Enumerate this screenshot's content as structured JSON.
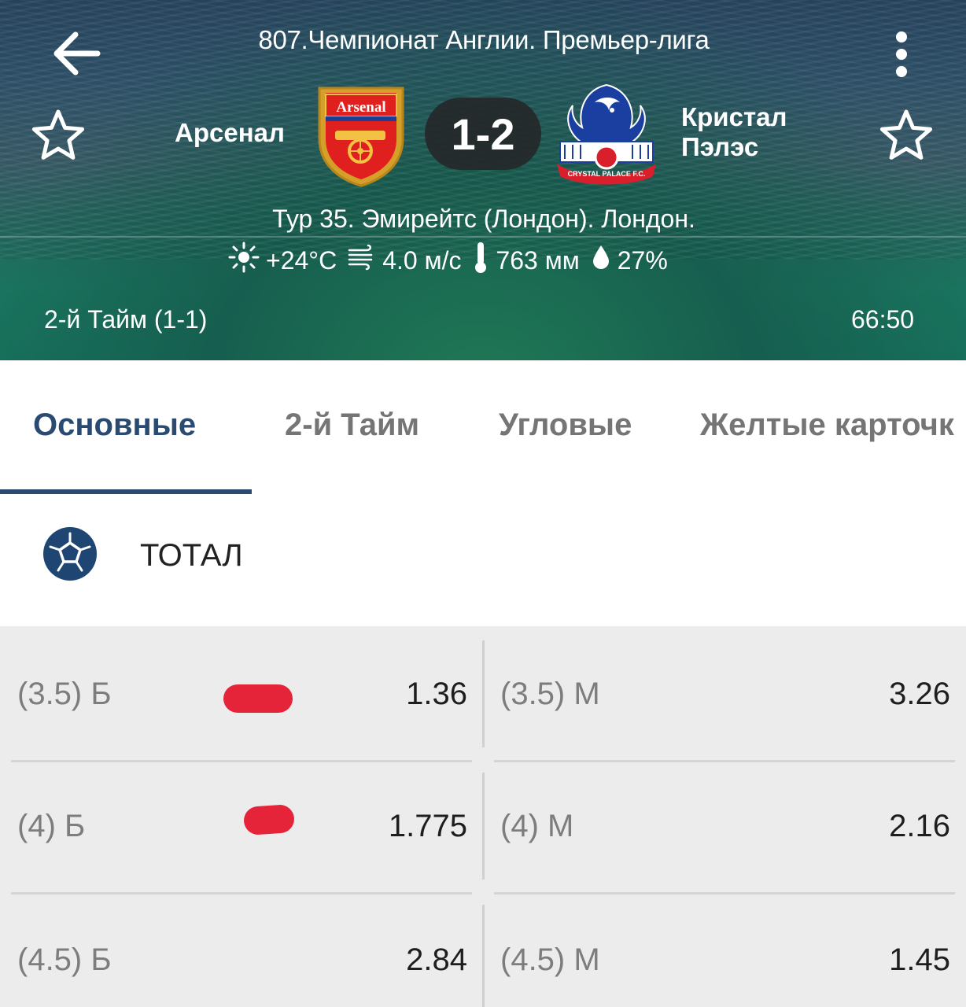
{
  "header": {
    "league": "807.Чемпионат Англии. Премьер-лига",
    "home_team": "Арсенал",
    "away_team_line1": "Кристал",
    "away_team_line2": "Пэлэс",
    "score": "1-2",
    "home_crest_text": "Arsenal",
    "away_crest_text": "CRYSTAL PALACE F.C.",
    "venue": "Тур 35. Эмирейтс (Лондон). Лондон.",
    "weather": {
      "temperature": "+24°C",
      "wind": "4.0 м/с",
      "pressure": "763 мм",
      "humidity": "27%"
    },
    "period": "2-й  Тайм (1-1)",
    "clock": "66:50"
  },
  "tabs": [
    {
      "label": "Основные",
      "active": true
    },
    {
      "label": "2-й  Тайм",
      "active": false
    },
    {
      "label": "Угловые",
      "active": false
    },
    {
      "label": "Желтые карточк",
      "active": false
    }
  ],
  "section": {
    "title": "ТОТАЛ"
  },
  "odds_rows": [
    {
      "over_label": "(3.5) Б",
      "over_odd": "1.36",
      "under_label": "(3.5) М",
      "under_odd": "3.26"
    },
    {
      "over_label": "(4) Б",
      "over_odd": "1.775",
      "under_label": "(4) М",
      "under_odd": "2.16"
    },
    {
      "over_label": "(4.5) Б",
      "over_odd": "2.84",
      "under_label": "(4.5) М",
      "under_odd": "1.45"
    }
  ],
  "colors": {
    "accent": "#2a4a72",
    "marker": "#e5243a",
    "odds_background": "#ececec"
  },
  "icons": [
    "back-arrow-icon",
    "more-vert-icon",
    "star-outline-icon",
    "sun-icon",
    "wind-icon",
    "thermometer-icon",
    "drop-icon",
    "soccer-ball-icon"
  ]
}
